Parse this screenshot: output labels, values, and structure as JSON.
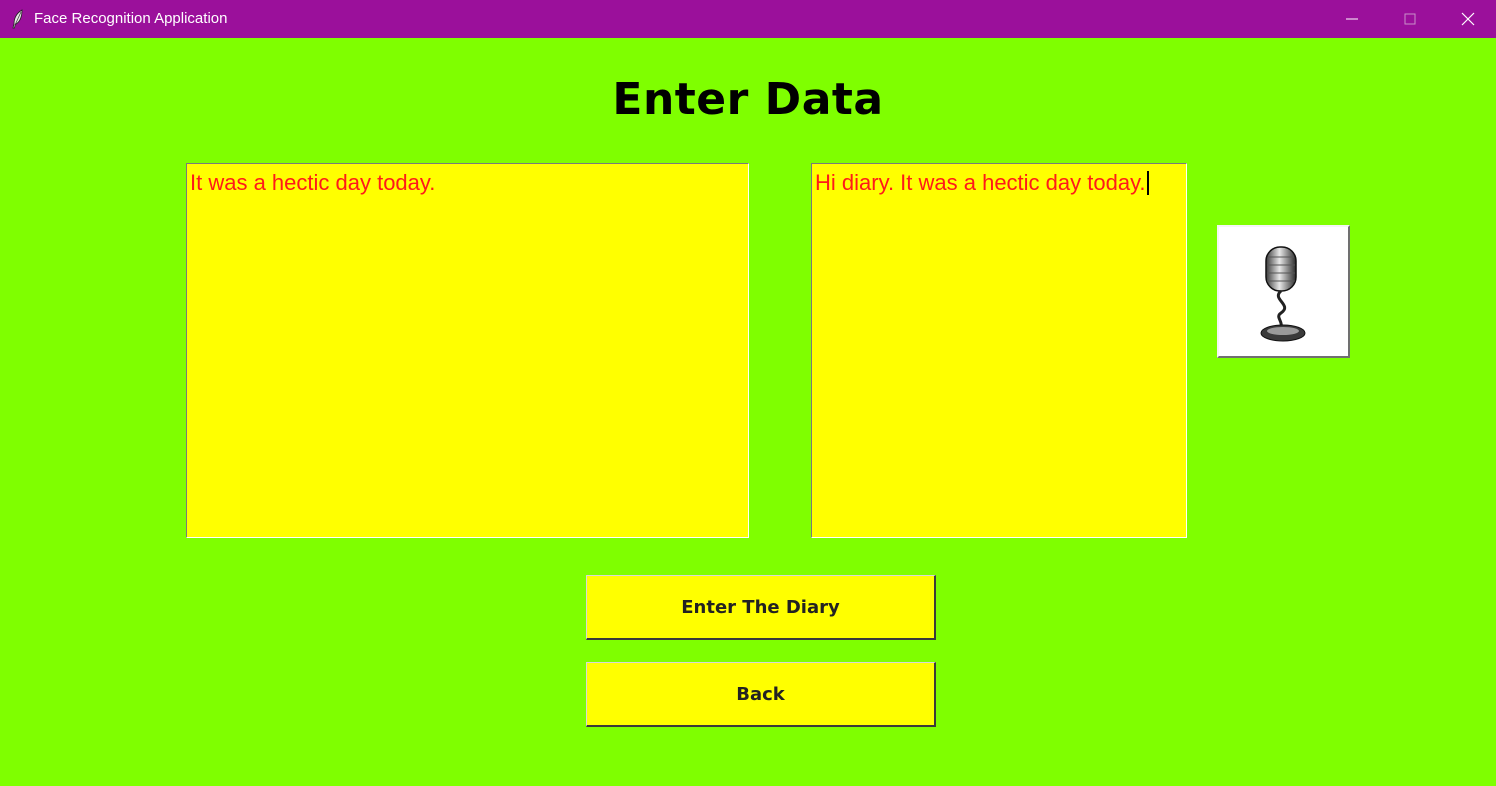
{
  "window": {
    "title": "Face Recognition Application",
    "icon": "feather-icon",
    "controls": [
      "minimize-icon",
      "maximize-icon",
      "close-icon"
    ]
  },
  "heading": "Enter Data",
  "left_textbox": {
    "value": "It was a hectic day today."
  },
  "right_textbox": {
    "value": "Hi diary. It was a hectic day today."
  },
  "mic_button": {
    "icon": "microphone-icon"
  },
  "buttons": {
    "enter_diary": "Enter The Diary",
    "back": "Back"
  },
  "colors": {
    "titlebar": "#9b109b",
    "background": "#7fff00",
    "textbox_bg": "#ffff00",
    "textbox_text": "#ff1a1a",
    "button_bg": "#ffff00"
  }
}
